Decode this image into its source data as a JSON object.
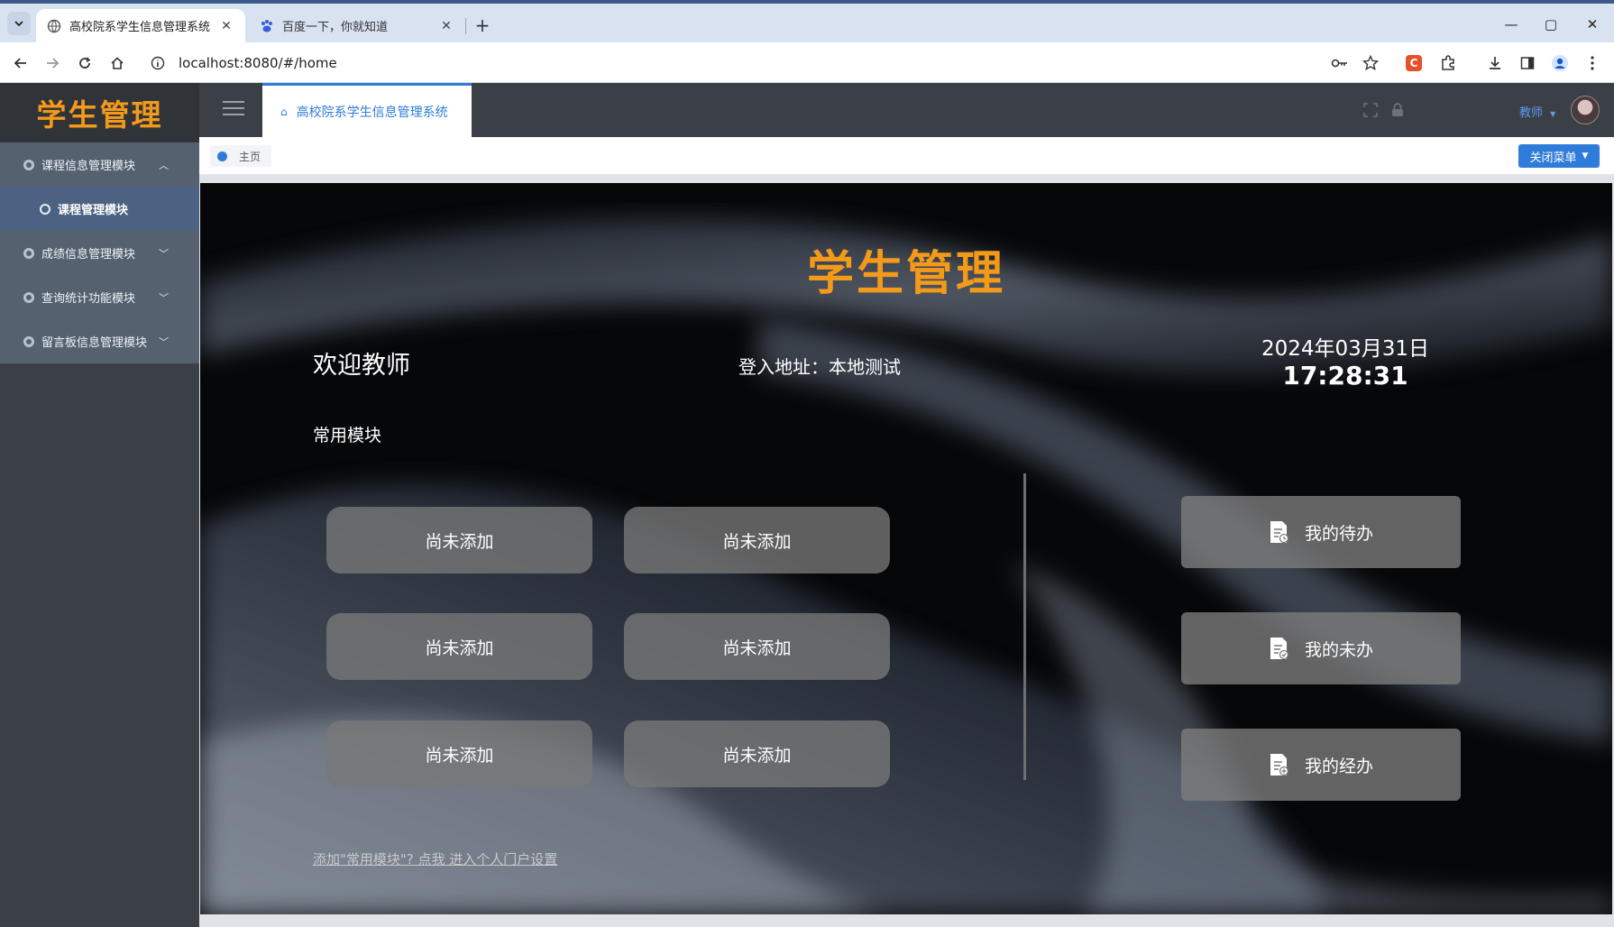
{
  "browser": {
    "tabs": [
      {
        "title": "高校院系学生信息管理系统",
        "active": true
      },
      {
        "title": "百度一下，你就知道",
        "active": false
      }
    ],
    "url": "localhost:8080/#/home"
  },
  "app": {
    "logo": "学生管理",
    "sidebar": {
      "items": [
        {
          "label": "课程信息管理模块",
          "expanded": true
        },
        {
          "label": "课程管理模块",
          "sub": true
        },
        {
          "label": "成绩信息管理模块",
          "expanded": false
        },
        {
          "label": "查询统计功能模块",
          "expanded": false
        },
        {
          "label": "留言板信息管理模块",
          "expanded": false
        }
      ]
    },
    "header": {
      "tab_label": "高校院系学生信息管理系统",
      "user": "教师"
    },
    "breadcrumb": {
      "label": "主页"
    },
    "close_menu": "关闭菜单",
    "hero": {
      "title": "学生管理",
      "welcome": "欢迎教师",
      "login_addr": "登入地址：本地测试",
      "date": "2024年03月31日",
      "time": "17:28:31",
      "section_label": "常用模块",
      "modules": [
        "尚未添加",
        "尚未添加",
        "尚未添加",
        "尚未添加",
        "尚未添加",
        "尚未添加"
      ],
      "tasks": [
        "我的待办",
        "我的未办",
        "我的经办"
      ],
      "portal_link": "添加\"常用模块\"? 点我 进入个人门户设置"
    }
  },
  "colors": {
    "accent": "#2f7bd9",
    "logo": "#f49a1a",
    "sidebar": "#3a4046",
    "submenu": "#4b6282"
  }
}
